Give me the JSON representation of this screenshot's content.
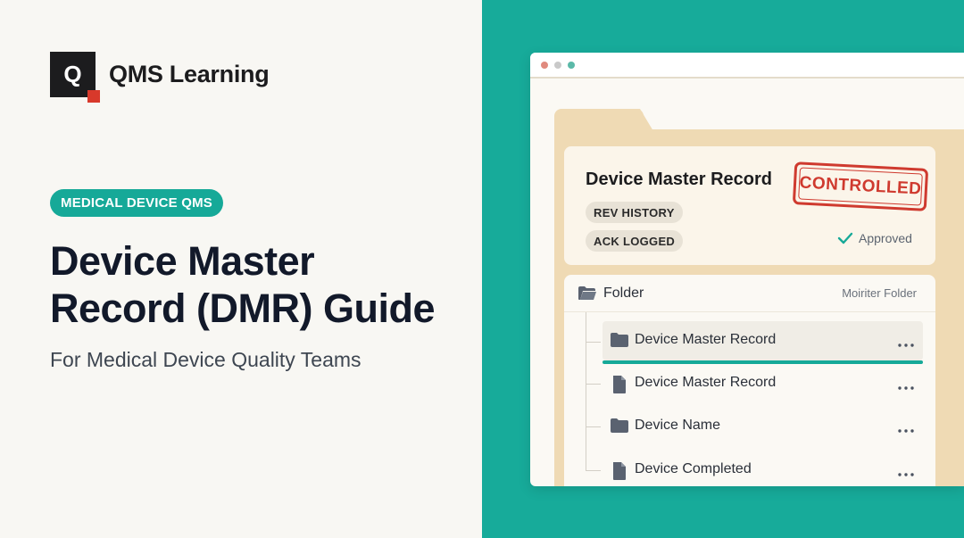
{
  "brand": {
    "logo_letter": "Q",
    "name": "QMS Learning",
    "accent": "#16a998",
    "logo_square_color": "#d8392b"
  },
  "hero": {
    "category_pill": "MEDICAL DEVICE QMS",
    "title_line1": "Device Master",
    "title_line2": "Record (DMR) Guide",
    "subtitle": "For Medical Device Quality Teams"
  },
  "mockup": {
    "window_dots": [
      "#e08a7e",
      "#c9c9c9",
      "#5bb9a8"
    ],
    "record_card": {
      "title": "Device Master Record",
      "tags": [
        "REV HISTORY",
        "ACK LOGGED"
      ],
      "stamp": "CONTROLLED",
      "status": "Approved",
      "status_icon": "checkmark-icon"
    },
    "file_list": {
      "header_icon": "open-folder-icon",
      "header_label": "Folder",
      "header_right": "Moiriter Folder",
      "rows": [
        {
          "icon": "folder-icon",
          "label": "Device Master Record",
          "selected": true
        },
        {
          "icon": "document-icon",
          "label": "Device Master Record",
          "selected": false
        },
        {
          "icon": "folder-icon",
          "label": "Device Name",
          "selected": false
        },
        {
          "icon": "document-icon",
          "label": "Device Completed",
          "selected": false
        }
      ]
    }
  }
}
